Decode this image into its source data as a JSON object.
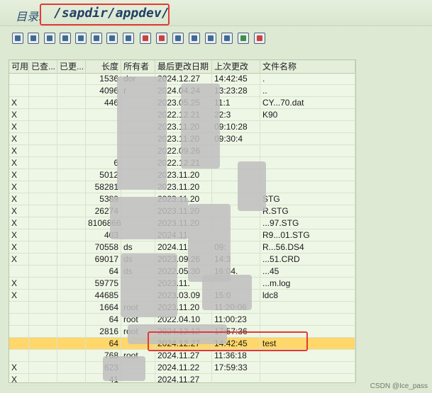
{
  "directory": {
    "label": "目录:",
    "path": "/sapdir/appdev/"
  },
  "toolbar": {
    "icons": [
      "refresh-icon",
      "find-icon",
      "copy-icon",
      "settings-icon",
      "print-icon",
      "filter-icon",
      "sort-icon",
      "export-icon",
      "navigate-icon",
      "info-icon",
      "table-icon",
      "layout-icon",
      "grid-icon",
      "copy2-icon",
      "attach-icon",
      "save-icon"
    ]
  },
  "table": {
    "headers": [
      "可用",
      "已查...",
      "已更...",
      "长度",
      "所有者",
      "最后更改日期",
      "上次更改",
      "文件名称"
    ],
    "rows": [
      {
        "avail": "",
        "size": "1536",
        "owner": "dor",
        "date": "2024.12.27",
        "time": "14:42:45",
        "name": "."
      },
      {
        "avail": "",
        "size": "4096",
        "owner": "r",
        "date": "2024.04.24",
        "time": "13:23:28",
        "name": ".."
      },
      {
        "avail": "X",
        "size": "446",
        "owner": "",
        "date": "2023.05.25",
        "time": "11:1",
        "name": "CY...70.dat"
      },
      {
        "avail": "X",
        "size": "",
        "owner": "",
        "date": "2022.12.21",
        "time": "22:3",
        "name": "K90"
      },
      {
        "avail": "X",
        "size": "",
        "owner": "",
        "date": "2023.11.20",
        "time": "09:10:28",
        "name": ""
      },
      {
        "avail": "X",
        "size": "",
        "owner": "",
        "date": "2023.11.20",
        "time": "09:30:4",
        "name": ""
      },
      {
        "avail": "X",
        "size": "",
        "owner": "",
        "date": "2022.09.26",
        "time": "",
        "name": ""
      },
      {
        "avail": "X",
        "size": "6",
        "owner": "",
        "date": "2022.12.21",
        "time": "",
        "name": ""
      },
      {
        "avail": "X",
        "size": "5012",
        "owner": "",
        "date": "2023.11.20",
        "time": "",
        "name": ""
      },
      {
        "avail": "X",
        "size": "58281",
        "owner": "",
        "date": "2023.11.20",
        "time": "",
        "name": ""
      },
      {
        "avail": "X",
        "size": "5389",
        "owner": "",
        "date": "2023.11.20",
        "time": "",
        "name": "STG"
      },
      {
        "avail": "X",
        "size": "26274",
        "owner": "",
        "date": "2023.11.20",
        "time": "",
        "name": "R.STG"
      },
      {
        "avail": "X",
        "size": "8106866",
        "owner": "",
        "date": "2023.11.20",
        "time": "",
        "name": "...97.STG"
      },
      {
        "avail": "X",
        "size": "403",
        "owner": "",
        "date": "2024.11.",
        "time": "",
        "name": "R9...01.STG"
      },
      {
        "avail": "X",
        "size": "70558",
        "owner": "ds",
        "date": "2024.11.",
        "time": "09:",
        "name": "R...56.DS4"
      },
      {
        "avail": "X",
        "size": "69017",
        "owner": "ds",
        "date": "2023.09.26",
        "time": "14:3",
        "name": "...51.CRD"
      },
      {
        "avail": "",
        "size": "64",
        "owner": "ds",
        "date": "2022.05.30",
        "time": "16:04.",
        "name": "...45"
      },
      {
        "avail": "X",
        "size": "59775",
        "owner": "",
        "date": "2023.11.",
        "time": "",
        "name": "...m.log"
      },
      {
        "avail": "X",
        "size": "44685",
        "owner": "",
        "date": "2023.03.09",
        "time": "15:0",
        "name": "ldc8"
      },
      {
        "avail": "",
        "size": "1664",
        "owner": "root",
        "date": "2023.11.20",
        "time": "11:20:06",
        "name": ""
      },
      {
        "avail": "",
        "size": "64",
        "owner": "root",
        "date": "2022.04.10",
        "time": "11:00:23",
        "name": ""
      },
      {
        "avail": "",
        "size": "2816",
        "owner": "root",
        "date": "2024.12.12",
        "time": "17:57:36",
        "name": ""
      },
      {
        "avail": "",
        "size": "64",
        "owner": "",
        "date": "2024.12.27",
        "time": "14:42:45",
        "name": "test"
      },
      {
        "avail": "",
        "size": "768",
        "owner": "root",
        "date": "2024.11.27",
        "time": "11:36:18",
        "name": ""
      },
      {
        "avail": "X",
        "size": "623",
        "owner": "",
        "date": "2024.11.22",
        "time": "17:59:33",
        "name": ""
      },
      {
        "avail": "X",
        "size": "41",
        "owner": "",
        "date": "2024.11.27",
        "time": "",
        "name": ""
      }
    ]
  },
  "watermark": "CSDN @Ice_pass"
}
